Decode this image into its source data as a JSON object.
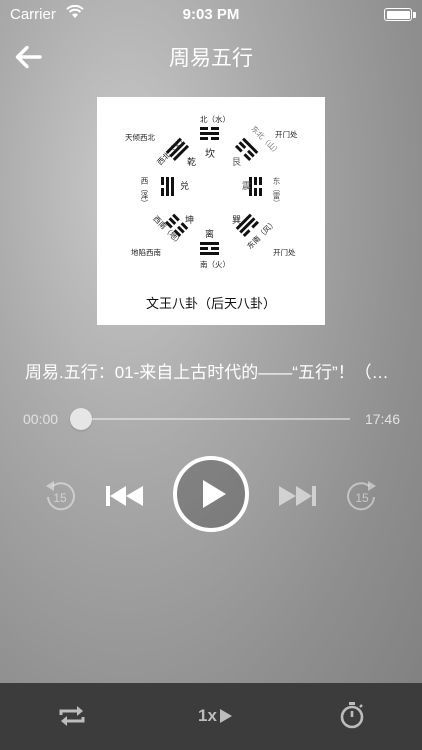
{
  "status_bar": {
    "carrier": "Carrier",
    "time": "9:03 PM"
  },
  "nav": {
    "title": "周易五行"
  },
  "artwork": {
    "caption": "文王八卦（后天八卦）",
    "labels": {
      "north": "北（水）",
      "north_trigram": "坎",
      "northwest": "天倾西北",
      "northwest_dir": "西北（天）",
      "northwest_trigram": "乾",
      "northeast_dir": "东北（山）",
      "northeast_trigram": "艮",
      "northeast_gate": "开门处",
      "east": "东（雷）",
      "east_trigram": "震",
      "west": "西（泽）",
      "west_trigram": "兑",
      "southwest_dir": "西南（地）",
      "southwest_trigram": "坤",
      "southwest": "地陷西南",
      "south": "南（火）",
      "south_trigram": "离",
      "southeast_dir": "东南（风）",
      "southeast_trigram": "巽",
      "southeast_gate": "开门处"
    }
  },
  "track": {
    "title": "周易.五行：01-来自上古时代的——“五行”！（…"
  },
  "progress": {
    "elapsed": "00:00",
    "duration": "17:46",
    "fraction": 0.0
  },
  "controls": {
    "skip_back_label": "15",
    "skip_forward_label": "15"
  },
  "toolbar": {
    "speed_label": "1x"
  }
}
